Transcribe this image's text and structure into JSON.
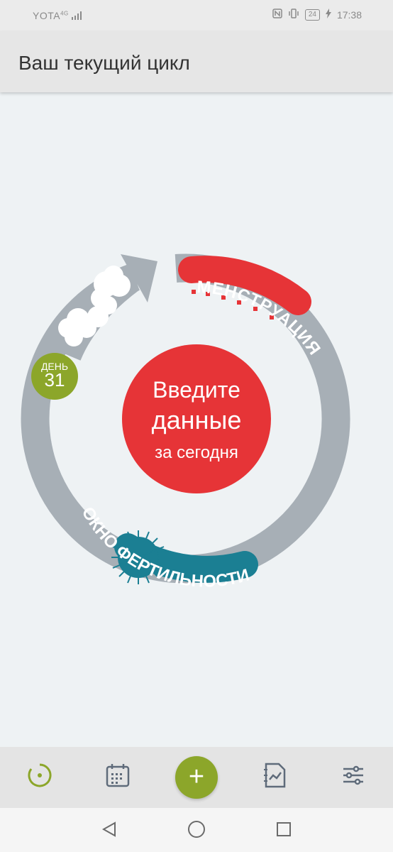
{
  "status_bar": {
    "carrier": "YOTA",
    "network": "4G",
    "battery": "24",
    "time": "17:38"
  },
  "header": {
    "title": "Ваш текущий цикл"
  },
  "cycle": {
    "day_label": "ДЕНЬ",
    "day_number": "31",
    "center_line1": "Введите",
    "center_line2": "данные",
    "center_line3": "за сегодня",
    "menstruation_label": "МЕНСТРУАЦИЯ",
    "fertility_label": "ОКНО ФЕРТИЛЬНОСТИ"
  },
  "colors": {
    "ring": "#a7afb6",
    "accent_red": "#e63437",
    "accent_green": "#8ca62a",
    "fertility_teal": "#1b7f93"
  },
  "bottom_nav": {
    "items": [
      "cycle-icon",
      "calendar-icon",
      "add-icon",
      "notes-chart-icon",
      "settings-sliders-icon"
    ],
    "add_label": "+"
  },
  "system_nav": {
    "buttons": [
      "back-icon",
      "home-icon",
      "recents-icon"
    ]
  }
}
